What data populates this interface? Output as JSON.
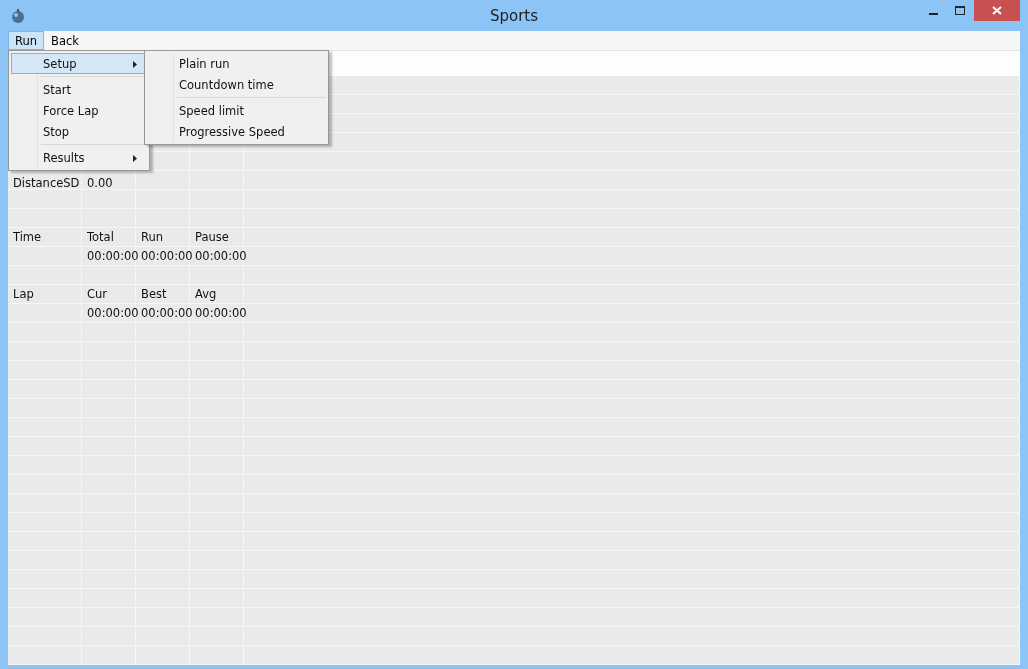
{
  "window": {
    "title": "Sports"
  },
  "menu_bar": [
    {
      "label": "Run",
      "selected": true
    },
    {
      "label": "Back",
      "selected": false
    }
  ],
  "run_menu": [
    {
      "kind": "item",
      "label": "Setup",
      "submenu": true,
      "selected": true
    },
    {
      "kind": "separator"
    },
    {
      "kind": "item",
      "label": "Start",
      "submenu": false,
      "selected": false
    },
    {
      "kind": "item",
      "label": "Force Lap",
      "submenu": false,
      "selected": false
    },
    {
      "kind": "item",
      "label": "Stop",
      "submenu": false,
      "selected": false
    },
    {
      "kind": "separator"
    },
    {
      "kind": "item",
      "label": "Results",
      "submenu": true,
      "selected": false
    }
  ],
  "setup_submenu": [
    {
      "kind": "item",
      "label": "Plain run"
    },
    {
      "kind": "item",
      "label": "Countdown time"
    },
    {
      "kind": "separator"
    },
    {
      "kind": "item",
      "label": "Speed limit"
    },
    {
      "kind": "item",
      "label": "Progressive Speed"
    }
  ],
  "distance": {
    "label": "DistanceSD",
    "value": "0.00"
  },
  "time": {
    "label": "Time",
    "columns": [
      "Total",
      "Run",
      "Pause"
    ],
    "values": [
      "00:00:00",
      "00:00:00",
      "00:00:00"
    ]
  },
  "lap": {
    "label": "Lap",
    "columns": [
      "Cur",
      "Best",
      "Avg"
    ],
    "values": [
      "00:00:00",
      "00:00:00",
      "00:00:00"
    ]
  }
}
